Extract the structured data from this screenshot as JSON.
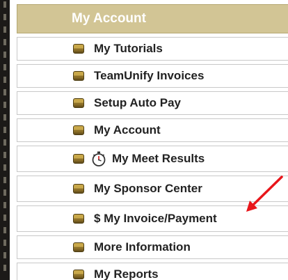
{
  "menu": {
    "header": "My Account",
    "items": [
      {
        "label": "My Tutorials",
        "icon": "bullet-icon"
      },
      {
        "label": "TeamUnify Invoices",
        "icon": "bullet-icon"
      },
      {
        "label": "Setup Auto Pay",
        "icon": "bullet-icon"
      },
      {
        "label": "My Account",
        "icon": "bullet-icon"
      },
      {
        "label": "My Meet Results",
        "icon": "bullet-icon",
        "extra_icon": "stopwatch-icon"
      },
      {
        "label": "My Sponsor Center",
        "icon": "bullet-icon"
      },
      {
        "label": "$ My Invoice/Payment",
        "icon": "bullet-icon"
      },
      {
        "label": "More Information",
        "icon": "bullet-icon"
      },
      {
        "label": "My Reports",
        "icon": "bullet-icon"
      }
    ]
  },
  "colors": {
    "header_bg": "#d2c595",
    "bullet": "#c9a84a",
    "annotation_arrow": "#e8161b"
  }
}
